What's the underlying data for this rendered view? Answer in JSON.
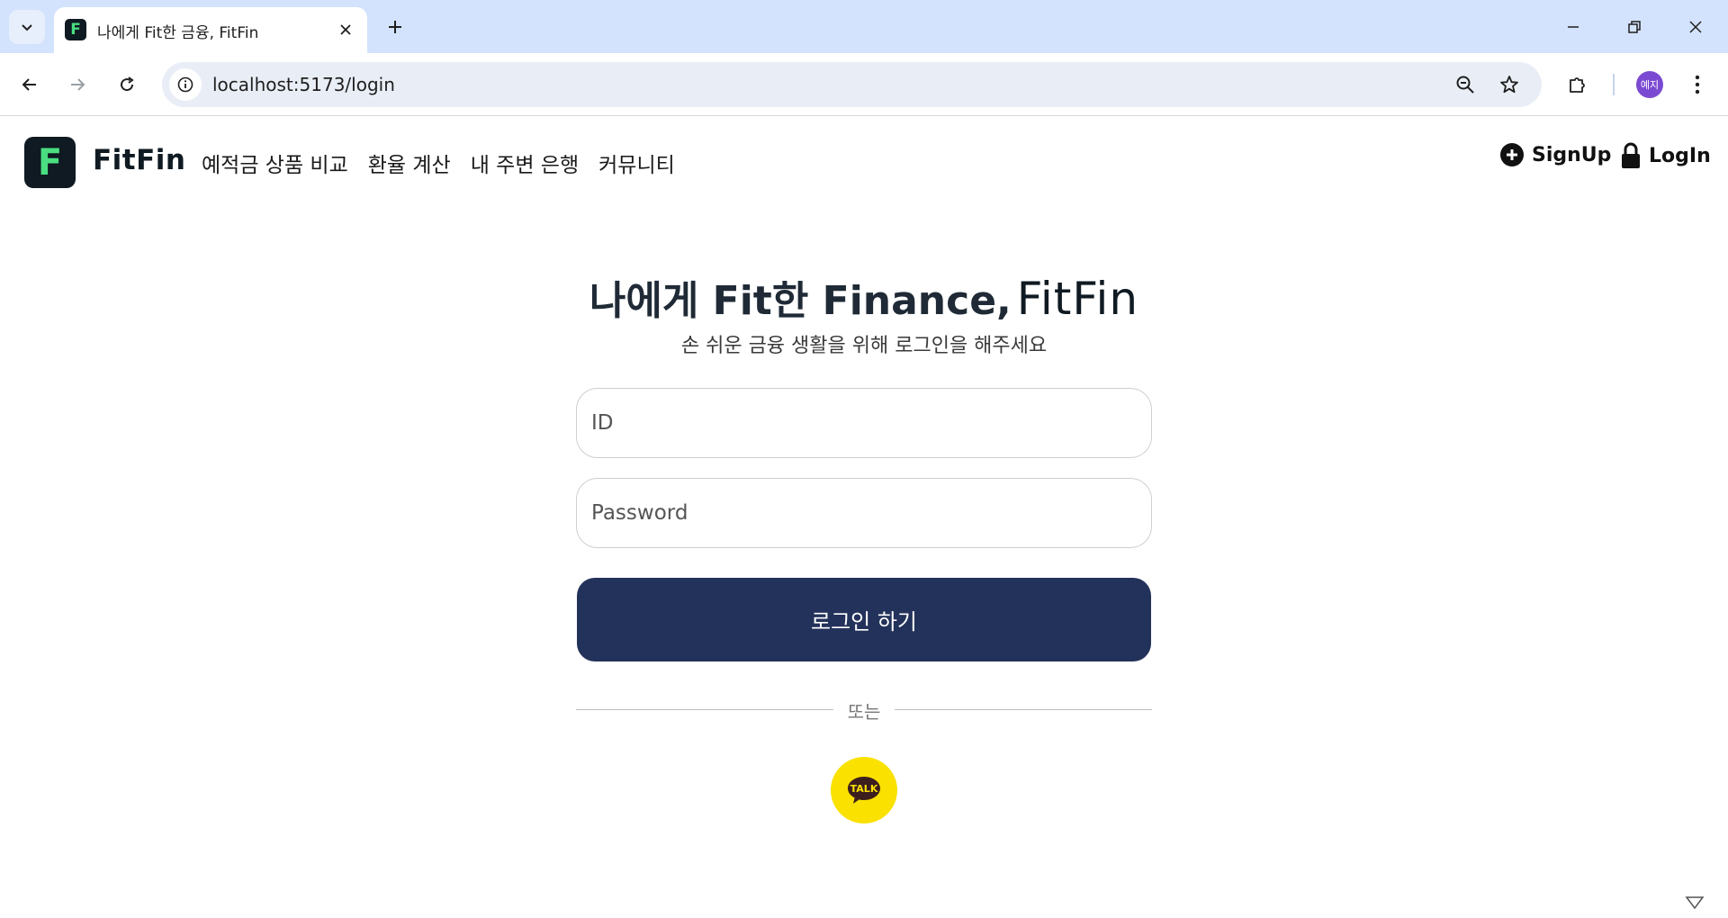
{
  "browser": {
    "tab_title": "나에게 Fit한 금융, FitFin",
    "tab_favicon_letter": "F",
    "url": "localhost:5173/login",
    "profile_label": "예지"
  },
  "site": {
    "logo_letter": "F",
    "logo_name": "FitFin",
    "nav": [
      {
        "label": "예적금 상품 비교"
      },
      {
        "label": "환율 계산"
      },
      {
        "label": "내 주변 은행"
      },
      {
        "label": "커뮤니티"
      }
    ],
    "signup_label": "SignUp",
    "login_label": "LogIn"
  },
  "login": {
    "headline": "나에게 Fit한 Finance,",
    "headline_brand": "FitFin",
    "subtitle": "손 쉬운 금융 생활을 위해 로그인을 해주세요",
    "id_placeholder": "ID",
    "password_placeholder": "Password",
    "submit_label": "로그인 하기",
    "divider_label": "또는",
    "kakao_label": "TALK"
  },
  "colors": {
    "brand_dark": "#0f1a22",
    "brand_green": "#4ade80",
    "button_navy": "#23325a",
    "kakao_yellow": "#fae100",
    "tabstrip": "#d3e3fd"
  }
}
